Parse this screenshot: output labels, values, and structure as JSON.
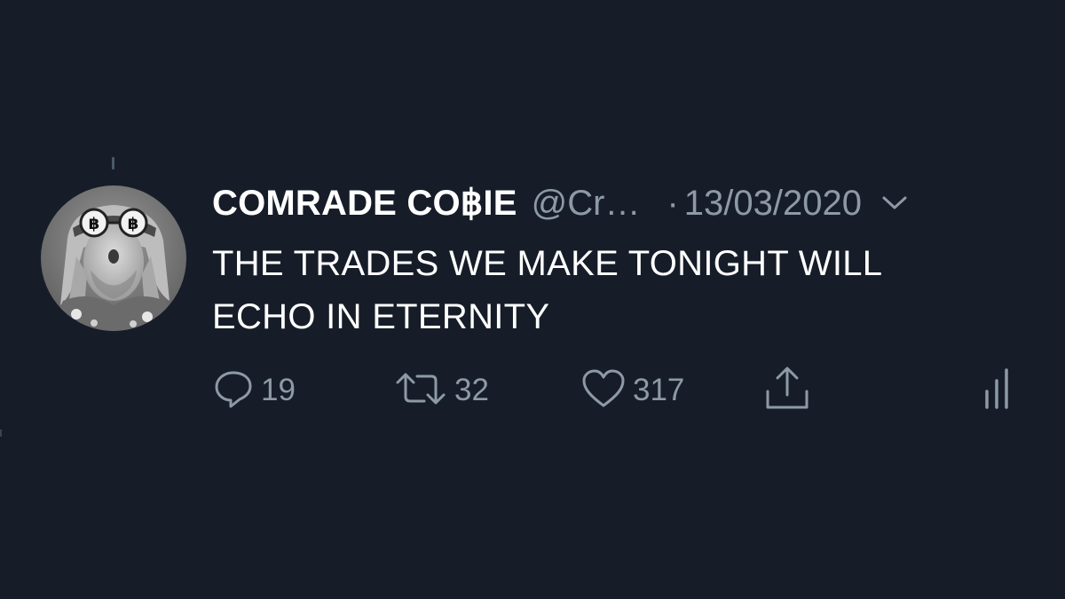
{
  "tweet": {
    "author": {
      "display_name": "COMRADE CO฿IE",
      "handle": "@Cr…",
      "avatar": "avatar-photo"
    },
    "separator": "·",
    "date": "13/03/2020",
    "text_lines": [
      "THE TRADES WE MAKE TONIGHT WILL",
      "ECHO IN ETERNITY"
    ],
    "actions": {
      "reply": {
        "icon": "reply-icon",
        "count": "19"
      },
      "retweet": {
        "icon": "retweet-icon",
        "count": "32"
      },
      "like": {
        "icon": "heart-icon",
        "count": "317"
      },
      "share": {
        "icon": "share-icon"
      },
      "analytics": {
        "icon": "analytics-icon"
      }
    }
  },
  "colors": {
    "background": "#161d28",
    "primary_text": "#ffffff",
    "secondary_text": "#8d9aa6"
  }
}
